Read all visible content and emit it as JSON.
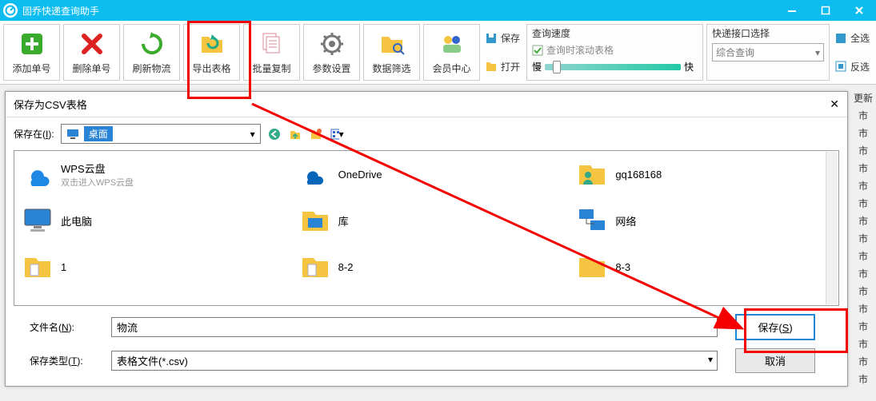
{
  "window": {
    "title": "固乔快递查询助手"
  },
  "toolbar": {
    "add": "添加单号",
    "delete": "删除单号",
    "refresh": "刷新物流",
    "export": "导出表格",
    "copy": "批量复制",
    "settings": "参数设置",
    "filter": "数据筛选",
    "member": "会员中心",
    "save": "保存",
    "open": "打开",
    "selectall": "全选",
    "invert": "反选"
  },
  "speed": {
    "title": "查询速度",
    "scroll_label": "查询时滚动表格",
    "slow": "慢",
    "fast": "快"
  },
  "api": {
    "title": "快递接口选择",
    "selected": "综合查询"
  },
  "dialog": {
    "title": "保存为CSV表格",
    "savein_label": "保存在(I):",
    "savein_value": "桌面",
    "filename_label": "文件名(N):",
    "filename_value": "物流",
    "filetype_label": "保存类型(T):",
    "filetype_value": "表格文件(*.csv)",
    "save_btn": "保存(S)",
    "cancel_btn": "取消"
  },
  "files": {
    "wps": {
      "name": "WPS云盘",
      "sub": "双击进入WPS云盘"
    },
    "onedrive": {
      "name": "OneDrive"
    },
    "user": {
      "name": "gq168168"
    },
    "thispc": {
      "name": "此电脑"
    },
    "library": {
      "name": "库"
    },
    "network": {
      "name": "网络"
    },
    "f1": {
      "name": "1"
    },
    "f82": {
      "name": "8-2"
    },
    "f83": {
      "name": "8-3"
    }
  },
  "rightcol": [
    "更新",
    "市",
    "市",
    "市",
    "市",
    "市",
    "市",
    "市",
    "市",
    "市",
    "市",
    "市",
    "市",
    "市",
    "市",
    "市",
    "市"
  ]
}
